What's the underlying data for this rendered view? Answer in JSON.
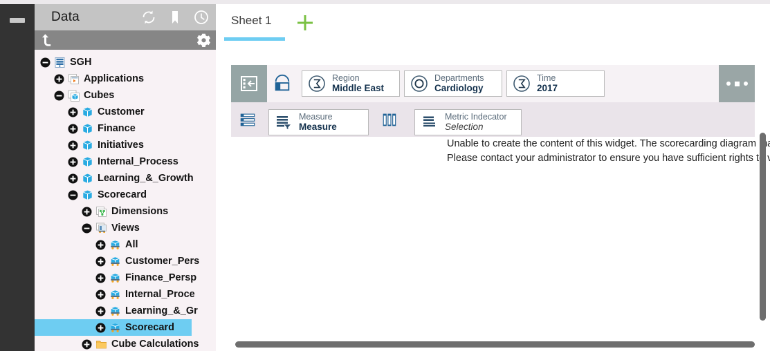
{
  "rail": {
    "menu_icon": "hamburger-icon"
  },
  "data_panel": {
    "title": "Data",
    "header_icons": [
      {
        "name": "refresh-icon"
      },
      {
        "name": "bookmark-icon"
      },
      {
        "name": "history-clock-icon"
      }
    ],
    "subbar": {
      "up_icon": "navigate-up-icon",
      "gear_icon": "gear-icon"
    },
    "tree": [
      {
        "label": "SGH",
        "depth": 0,
        "toggle": "minus",
        "icon": "server-icon",
        "selected": false
      },
      {
        "label": "Applications",
        "depth": 1,
        "toggle": "plus",
        "icon": "applications-icon",
        "selected": false
      },
      {
        "label": "Cubes",
        "depth": 1,
        "toggle": "minus",
        "icon": "cubes-icon",
        "selected": false
      },
      {
        "label": "Customer",
        "depth": 2,
        "toggle": "plus",
        "icon": "cube-icon",
        "selected": false
      },
      {
        "label": "Finance",
        "depth": 2,
        "toggle": "plus",
        "icon": "cube-icon",
        "selected": false
      },
      {
        "label": "Initiatives",
        "depth": 2,
        "toggle": "plus",
        "icon": "cube-icon",
        "selected": false
      },
      {
        "label": "Internal_Process",
        "depth": 2,
        "toggle": "plus",
        "icon": "cube-icon",
        "selected": false
      },
      {
        "label": "Learning_&_Growth",
        "depth": 2,
        "toggle": "plus",
        "icon": "cube-icon",
        "selected": false
      },
      {
        "label": "Scorecard",
        "depth": 2,
        "toggle": "minus",
        "icon": "cube-icon",
        "selected": false
      },
      {
        "label": "Dimensions",
        "depth": 3,
        "toggle": "plus",
        "icon": "dimensions-icon",
        "selected": false
      },
      {
        "label": "Views",
        "depth": 3,
        "toggle": "minus",
        "icon": "views-icon",
        "selected": false
      },
      {
        "label": "All",
        "depth": 4,
        "toggle": "plus",
        "icon": "view-icon",
        "selected": false
      },
      {
        "label": "Customer_Pers",
        "depth": 4,
        "toggle": "plus",
        "icon": "view-icon",
        "selected": false
      },
      {
        "label": "Finance_Persp",
        "depth": 4,
        "toggle": "plus",
        "icon": "view-icon",
        "selected": false
      },
      {
        "label": "Internal_Proce",
        "depth": 4,
        "toggle": "plus",
        "icon": "view-icon",
        "selected": false
      },
      {
        "label": "Learning_&_Gr",
        "depth": 4,
        "toggle": "plus",
        "icon": "view-icon",
        "selected": false
      },
      {
        "label": "Scorecard",
        "depth": 4,
        "toggle": "plus",
        "icon": "view-icon",
        "selected": true
      },
      {
        "label": "Cube Calculations",
        "depth": 3,
        "toggle": "plus",
        "icon": "folder-icon",
        "selected": false
      }
    ]
  },
  "main": {
    "tabs": [
      {
        "label": "Sheet 1",
        "active": true
      }
    ],
    "add_sheet_icon": "plus-icon",
    "toolbar_row1": {
      "collapse_icon": "collapse-panel-icon",
      "widget_icon": "widget-icon",
      "chips": [
        {
          "icon": "sum-icon",
          "sub": "Region",
          "main": "Middle East",
          "italic": false
        },
        {
          "icon": "circle-icon",
          "sub": "Departments",
          "main": "Cardiology",
          "italic": false
        },
        {
          "icon": "sum-icon",
          "sub": "Time",
          "main": "2017",
          "italic": false
        }
      ],
      "more_icon": "more-options-icon"
    },
    "toolbar_row2": {
      "rows_icon": "rows-icon",
      "columns_icon": "columns-icon",
      "chips": [
        {
          "icon": "measure-filter-icon",
          "sub": "Measure",
          "main": "Measure",
          "italic": false
        },
        {
          "icon": "list-icon",
          "sub": "Metric Indecator",
          "main": "Selection",
          "italic": true
        }
      ]
    },
    "error": {
      "line1": "Unable to create the content of this widget. The scorecarding diagram may have been removed or is inaccessible.",
      "line2": "Please contact your administrator to ensure you have sufficient rights to view this widget."
    },
    "scrollbars": {
      "vertical": "vertical-scrollbar",
      "horizontal": "horizontal-scrollbar"
    }
  },
  "colors": {
    "rail": "#333333",
    "panel_bg": "#f8f2f5",
    "panel_header": "#c4c4c4",
    "panel_subbar": "#868686",
    "selection": "#6ecdf2",
    "accent_green": "#7ac143",
    "toolbar_row1": "#f6f2f5",
    "toolbar_row2": "#eae4ea",
    "icon_blue": "#1f6296",
    "cube_blue": "#29abe2",
    "scrollbar": "#6e6e6e"
  }
}
